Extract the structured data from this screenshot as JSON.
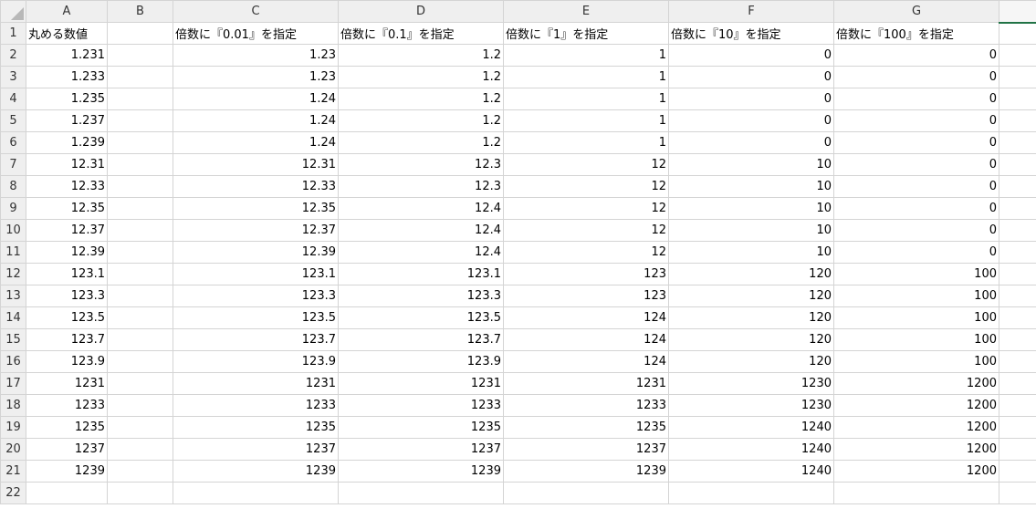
{
  "columns": [
    "A",
    "B",
    "C",
    "D",
    "E",
    "F",
    "G",
    ""
  ],
  "headers": [
    "丸める数値",
    "",
    "倍数に『0.01』を指定",
    "倍数に『0.1』を指定",
    "倍数に『1』を指定",
    "倍数に『10』を指定",
    "倍数に『100』を指定",
    ""
  ],
  "rows": [
    [
      "1.231",
      "",
      "1.23",
      "1.2",
      "1",
      "0",
      "0"
    ],
    [
      "1.233",
      "",
      "1.23",
      "1.2",
      "1",
      "0",
      "0"
    ],
    [
      "1.235",
      "",
      "1.24",
      "1.2",
      "1",
      "0",
      "0"
    ],
    [
      "1.237",
      "",
      "1.24",
      "1.2",
      "1",
      "0",
      "0"
    ],
    [
      "1.239",
      "",
      "1.24",
      "1.2",
      "1",
      "0",
      "0"
    ],
    [
      "12.31",
      "",
      "12.31",
      "12.3",
      "12",
      "10",
      "0"
    ],
    [
      "12.33",
      "",
      "12.33",
      "12.3",
      "12",
      "10",
      "0"
    ],
    [
      "12.35",
      "",
      "12.35",
      "12.4",
      "12",
      "10",
      "0"
    ],
    [
      "12.37",
      "",
      "12.37",
      "12.4",
      "12",
      "10",
      "0"
    ],
    [
      "12.39",
      "",
      "12.39",
      "12.4",
      "12",
      "10",
      "0"
    ],
    [
      "123.1",
      "",
      "123.1",
      "123.1",
      "123",
      "120",
      "100"
    ],
    [
      "123.3",
      "",
      "123.3",
      "123.3",
      "123",
      "120",
      "100"
    ],
    [
      "123.5",
      "",
      "123.5",
      "123.5",
      "124",
      "120",
      "100"
    ],
    [
      "123.7",
      "",
      "123.7",
      "123.7",
      "124",
      "120",
      "100"
    ],
    [
      "123.9",
      "",
      "123.9",
      "123.9",
      "124",
      "120",
      "100"
    ],
    [
      "1231",
      "",
      "1231",
      "1231",
      "1231",
      "1230",
      "1200"
    ],
    [
      "1233",
      "",
      "1233",
      "1233",
      "1233",
      "1230",
      "1200"
    ],
    [
      "1235",
      "",
      "1235",
      "1235",
      "1235",
      "1240",
      "1200"
    ],
    [
      "1237",
      "",
      "1237",
      "1237",
      "1237",
      "1240",
      "1200"
    ],
    [
      "1239",
      "",
      "1239",
      "1239",
      "1239",
      "1240",
      "1200"
    ],
    [
      "",
      "",
      "",
      "",
      "",
      "",
      ""
    ]
  ],
  "row_numbers": [
    "1",
    "2",
    "3",
    "4",
    "5",
    "6",
    "7",
    "8",
    "9",
    "10",
    "11",
    "12",
    "13",
    "14",
    "15",
    "16",
    "17",
    "18",
    "19",
    "20",
    "21",
    "22"
  ],
  "colors": {
    "header_bg": "#efefef",
    "gridline": "#d4d4d4",
    "selection_accent": "#217346"
  }
}
